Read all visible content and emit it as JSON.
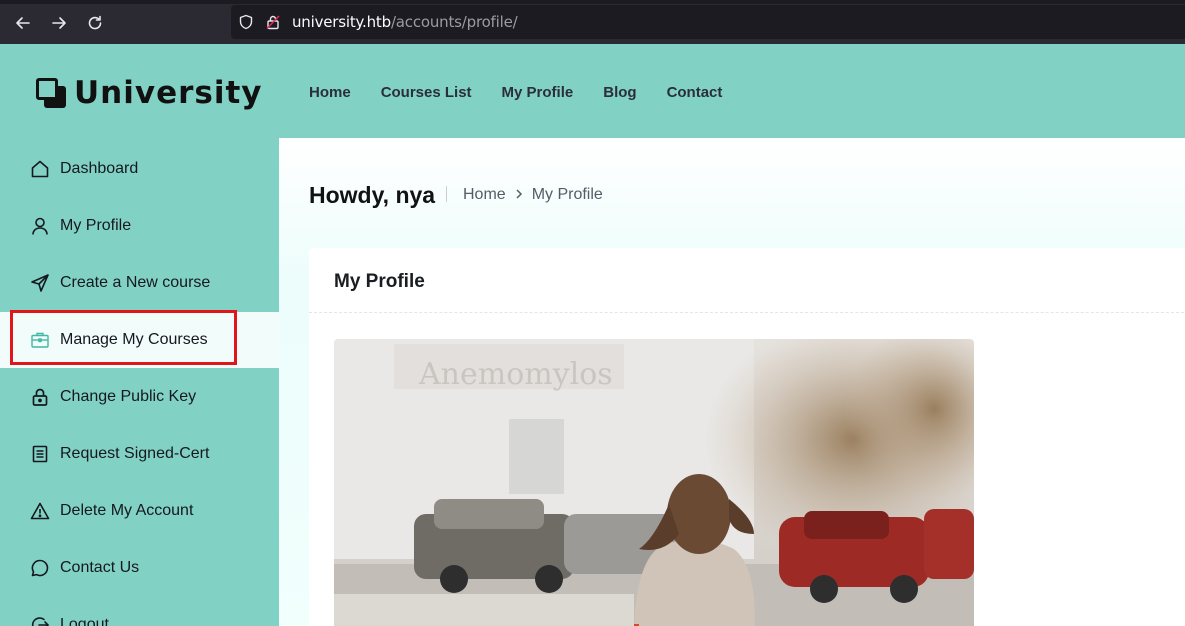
{
  "browser": {
    "url_host": "university.htb",
    "url_path": "/accounts/profile/"
  },
  "header": {
    "logo_text": "University",
    "nav": [
      "Home",
      "Courses List",
      "My Profile",
      "Blog",
      "Contact"
    ]
  },
  "sidebar": {
    "items": [
      {
        "label": "Dashboard",
        "icon": "home-icon"
      },
      {
        "label": "My Profile",
        "icon": "user-icon"
      },
      {
        "label": "Create a New course",
        "icon": "send-icon"
      },
      {
        "label": "Manage My Courses",
        "icon": "briefcase-icon",
        "active": true
      },
      {
        "label": "Change Public Key",
        "icon": "lock-icon"
      },
      {
        "label": "Request Signed-Cert",
        "icon": "document-icon"
      },
      {
        "label": "Delete My Account",
        "icon": "warning-icon"
      },
      {
        "label": "Contact Us",
        "icon": "chat-icon"
      },
      {
        "label": "Logout",
        "icon": "logout-icon"
      }
    ]
  },
  "main": {
    "greeting": "Howdy, nya",
    "breadcrumb": [
      "Home",
      "My Profile"
    ],
    "card_title": "My Profile"
  },
  "colors": {
    "accent": "#82d1c5",
    "highlight": "#e0161a"
  }
}
